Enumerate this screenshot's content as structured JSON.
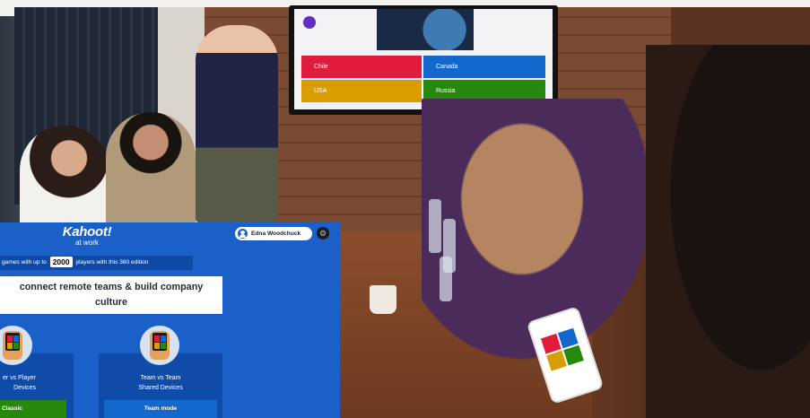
{
  "photo": {
    "tv_answers": [
      "Chile",
      "Canada",
      "USA",
      "Russia"
    ],
    "colors": {
      "red": "#e21b3c",
      "blue": "#1368ce",
      "yellow": "#d89e00",
      "green": "#26890c"
    }
  },
  "kahoot": {
    "logo_main": "Kahoot!",
    "logo_sub": "at work",
    "user_name": "Edna Woodchuck",
    "settings_icon": "gear-icon",
    "info_prefix": "games with up to",
    "info_number": "2000",
    "info_suffix": "players with this 360 edition",
    "headline": "connect remote teams & build company culture",
    "modes": [
      {
        "line1": "er vs Player",
        "line2": "Devices",
        "button": "Classic"
      },
      {
        "line1": "Team vs Team",
        "line2": "Shared Devices",
        "button": "Team mode"
      }
    ],
    "colors": {
      "panel": "#1b60c9",
      "classic": "#26890c",
      "team": "#1368ce"
    }
  }
}
